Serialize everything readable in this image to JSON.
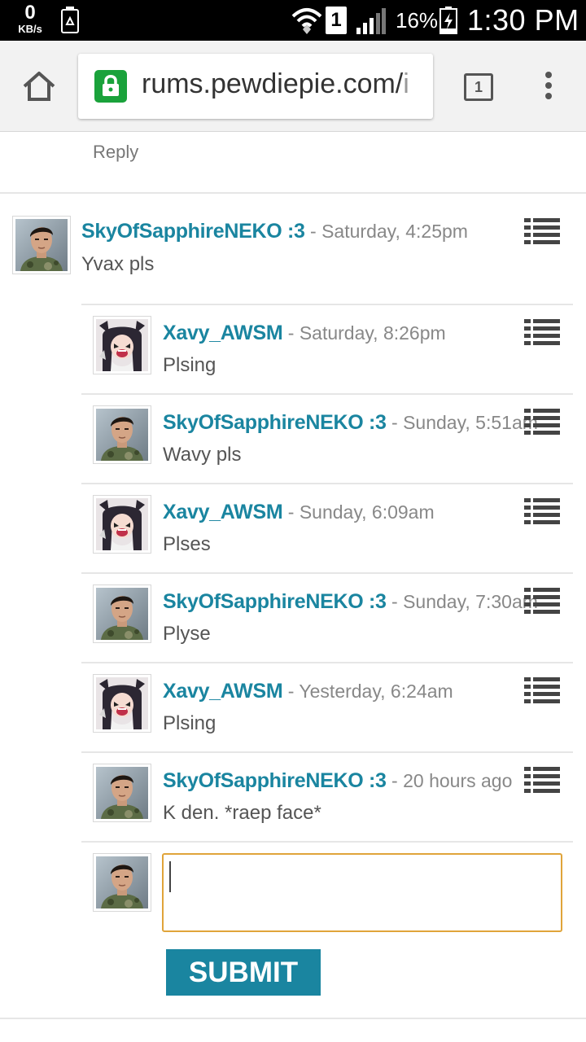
{
  "status_bar": {
    "net_speed_value": "0",
    "net_speed_unit": "KB/s",
    "sim_slot": "1",
    "battery_percent": "16%",
    "time": "1:30 PM"
  },
  "browser": {
    "url_main": "rums.pewdiepie.com/",
    "url_overflow": "i",
    "tab_count": "1"
  },
  "thread": {
    "reply_label": "Reply",
    "comments": [
      {
        "author": "SkyOfSapphireNEKO :3",
        "separator": " - ",
        "time": "Saturday, 4:25pm",
        "text": "Yvax pls",
        "avatar": "boy-avatar"
      },
      {
        "author": "Xavy_AWSM",
        "separator": " - ",
        "time": "Saturday, 8:26pm",
        "text": "Plsing",
        "avatar": "anime-avatar"
      },
      {
        "author": "SkyOfSapphireNEKO :3",
        "separator": " - ",
        "time": "Sunday, 5:51am",
        "text": "Wavy pls",
        "avatar": "boy-avatar"
      },
      {
        "author": "Xavy_AWSM",
        "separator": " - ",
        "time": "Sunday, 6:09am",
        "text": "Plses",
        "avatar": "anime-avatar"
      },
      {
        "author": "SkyOfSapphireNEKO :3",
        "separator": " - ",
        "time": "Sunday, 7:30am",
        "text": "Plyse",
        "avatar": "boy-avatar"
      },
      {
        "author": "Xavy_AWSM",
        "separator": " - ",
        "time": "Yesterday, 6:24am",
        "text": "Plsing",
        "avatar": "anime-avatar"
      },
      {
        "author": "SkyOfSapphireNEKO :3",
        "separator": " - ",
        "time": "20 hours ago",
        "text": "K den. *raep face*",
        "avatar": "boy-avatar"
      }
    ]
  },
  "reply_box": {
    "value": "",
    "submit_label": "SUBMIT"
  },
  "colors": {
    "author": "#1a85a0",
    "submit_bg": "#1a85a0",
    "input_border": "#e0a43a",
    "lock_bg": "#1aa23b"
  }
}
